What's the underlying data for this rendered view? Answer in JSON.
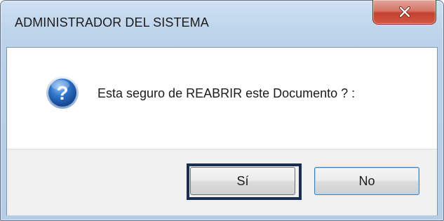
{
  "window": {
    "title": "ADMINISTRADOR DEL SISTEMA",
    "close_icon": "close-x-icon"
  },
  "dialog": {
    "icon": "question-icon",
    "message": "Esta seguro de REABRIR este Documento ? :"
  },
  "buttons": {
    "yes_label": "Sí",
    "no_label": "No"
  },
  "colors": {
    "titlebar": "#bfd5ec",
    "close_button": "#c4402f",
    "focus_border": "#1c2e4f",
    "button_area": "#f0f0f0"
  }
}
